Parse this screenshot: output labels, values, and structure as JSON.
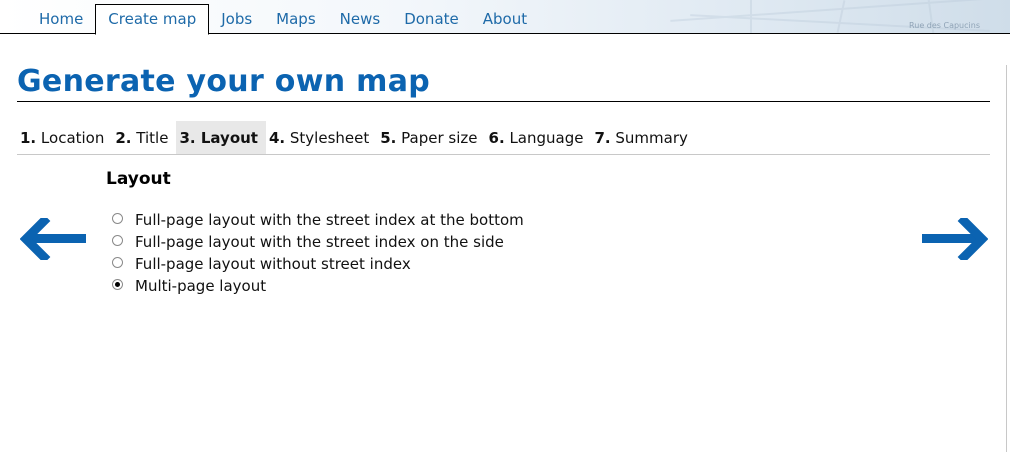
{
  "nav": {
    "items": [
      {
        "label": "Home",
        "active": false
      },
      {
        "label": "Create map",
        "active": true
      },
      {
        "label": "Jobs",
        "active": false
      },
      {
        "label": "Maps",
        "active": false
      },
      {
        "label": "News",
        "active": false
      },
      {
        "label": "Donate",
        "active": false
      },
      {
        "label": "About",
        "active": false
      }
    ],
    "map_street_label": "Rue des Capucins"
  },
  "page": {
    "title": "Generate your own map"
  },
  "steps": [
    {
      "num": "1.",
      "label": "Location",
      "active": false
    },
    {
      "num": "2.",
      "label": "Title",
      "active": false
    },
    {
      "num": "3.",
      "label": "Layout",
      "active": true
    },
    {
      "num": "4.",
      "label": "Stylesheet",
      "active": false
    },
    {
      "num": "5.",
      "label": "Paper size",
      "active": false
    },
    {
      "num": "6.",
      "label": "Language",
      "active": false
    },
    {
      "num": "7.",
      "label": "Summary",
      "active": false
    }
  ],
  "layout_section": {
    "heading": "Layout",
    "options": [
      {
        "label": "Full-page layout with the street index at the bottom",
        "selected": false
      },
      {
        "label": "Full-page layout with the street index on the side",
        "selected": false
      },
      {
        "label": "Full-page layout without street index",
        "selected": false
      },
      {
        "label": "Multi-page layout",
        "selected": true
      }
    ]
  },
  "navigation_arrows": {
    "prev_icon": "arrow-left-icon",
    "next_icon": "arrow-right-icon",
    "color": "#0b63b1"
  },
  "colors": {
    "accent": "#0b63b1",
    "link": "#1e6aa8",
    "active_step_bg": "#e8e8e8"
  }
}
